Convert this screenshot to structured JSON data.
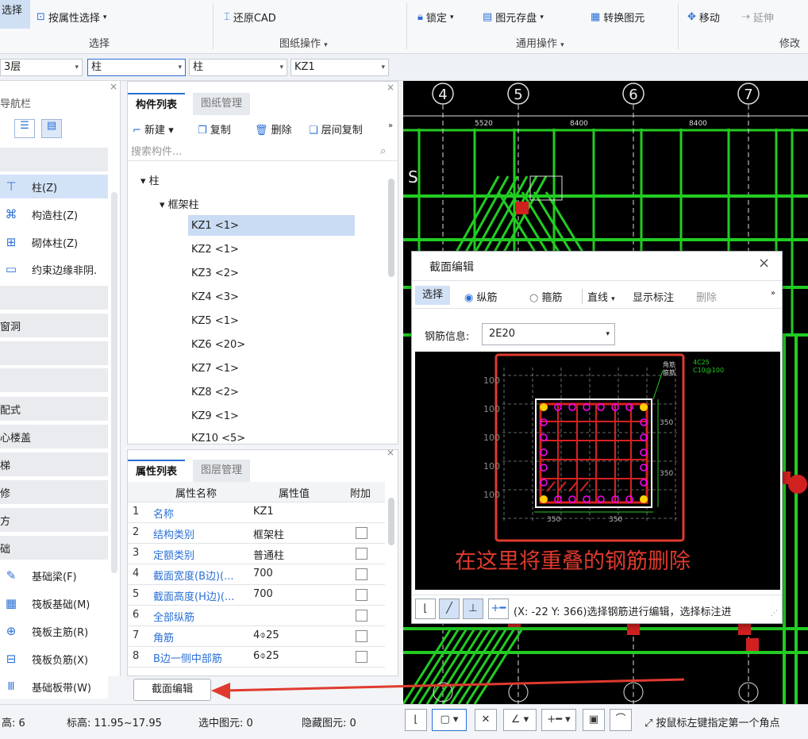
{
  "ribbon": {
    "select_big": "选择",
    "attr_select": "按属性选择",
    "restore_cad": "还原CAD",
    "lock": "锁定",
    "store": "图元存盘",
    "convert": "转换图元",
    "move": "移动",
    "extend": "延伸",
    "groups": {
      "select": "选择",
      "drawing": "图纸操作",
      "common": "通用操作",
      "modify": "修改"
    }
  },
  "toolbar2": {
    "floor": "3层",
    "cat": "柱",
    "type": "柱",
    "item": "KZ1"
  },
  "nav": {
    "title": "导航栏",
    "items": [
      {
        "label": "柱(Z)",
        "icon": "column-icon"
      },
      {
        "label": "构造柱(Z)",
        "icon": "constructional-column-icon"
      },
      {
        "label": "砌体柱(Z)",
        "icon": "masonry-column-icon"
      },
      {
        "label": "约束边缘非阴.",
        "icon": "edge-column-icon"
      },
      {
        "label": "窗洞"
      },
      {
        "label": "配式"
      },
      {
        "label": "心楼盖"
      },
      {
        "label": "梯"
      },
      {
        "label": "修"
      },
      {
        "label": "方"
      },
      {
        "label": "础"
      },
      {
        "label": "基础梁(F)",
        "icon": "foundation-beam-icon"
      },
      {
        "label": "筏板基础(M)",
        "icon": "raft-foundation-icon"
      },
      {
        "label": "筏板主筋(R)",
        "icon": "raft-main-rebar-icon"
      },
      {
        "label": "筏板负筋(X)",
        "icon": "raft-negative-rebar-icon"
      },
      {
        "label": "基础板带(W)",
        "icon": "foundation-strip-icon"
      }
    ]
  },
  "comp": {
    "tab_list": "构件列表",
    "tab_drawing": "图纸管理",
    "new": "新建",
    "copy": "复制",
    "delete": "删除",
    "floor_copy": "层间复制",
    "search_placeholder": "搜索构件...",
    "root": "柱",
    "group": "框架柱",
    "items": [
      "KZ1 <1>",
      "KZ2 <1>",
      "KZ3 <2>",
      "KZ4 <3>",
      "KZ5 <1>",
      "KZ6 <20>",
      "KZ7 <1>",
      "KZ8 <2>",
      "KZ9 <1>",
      "KZ10 <5>"
    ]
  },
  "props": {
    "tab_attr": "属性列表",
    "tab_layer": "图层管理",
    "headers": [
      "属性名称",
      "属性值",
      "附加"
    ],
    "rows": [
      {
        "n": "1",
        "name": "名称",
        "value": "KZ1"
      },
      {
        "n": "2",
        "name": "结构类别",
        "value": "框架柱"
      },
      {
        "n": "3",
        "name": "定额类别",
        "value": "普通柱"
      },
      {
        "n": "4",
        "name": "截面宽度(B边)(...",
        "value": "700"
      },
      {
        "n": "5",
        "name": "截面高度(H边)(...",
        "value": "700"
      },
      {
        "n": "6",
        "name": "全部纵筋",
        "value": ""
      },
      {
        "n": "7",
        "name": "角筋",
        "value": "4⌽25"
      },
      {
        "n": "8",
        "name": "B边一侧中部筋",
        "value": "6⌽25"
      }
    ],
    "section_button": "截面编辑"
  },
  "cad": {
    "axes": [
      "4",
      "5",
      "6",
      "7"
    ],
    "axis_s": "S",
    "dims": [
      "5520",
      "8400",
      "8400"
    ]
  },
  "dialog": {
    "title": "截面编辑",
    "select": "选择",
    "radio_long": "纵筋",
    "radio_stirrup": "箍筋",
    "line": "直线",
    "show_label": "显示标注",
    "delete": "删除",
    "rebar_label": "钢筋信息:",
    "rebar_value": "2E20",
    "annotation": "在这里将重叠的钢筋删除",
    "status": "(X: -22 Y: 366)选择钢筋进行编辑，选择标注进",
    "dims": [
      "350",
      "350"
    ],
    "callout": [
      "4C25",
      "C10@100"
    ],
    "callout_small": [
      "角筋",
      "箍筋"
    ]
  },
  "status": {
    "layer_label": "高:",
    "layer_val": "6",
    "elev": "标高:",
    "elev_val": "11.95~17.95",
    "selected": "选中图元:",
    "selected_val": "0",
    "hidden": "隐藏图元:",
    "hidden_val": "0",
    "hint": "按鼠标左键指定第一个角点"
  },
  "colors": {
    "accent": "#2a6fd6",
    "annotation": "#e03a2e",
    "rebar": "#ff00ff",
    "cad_green": "#22cc22"
  }
}
